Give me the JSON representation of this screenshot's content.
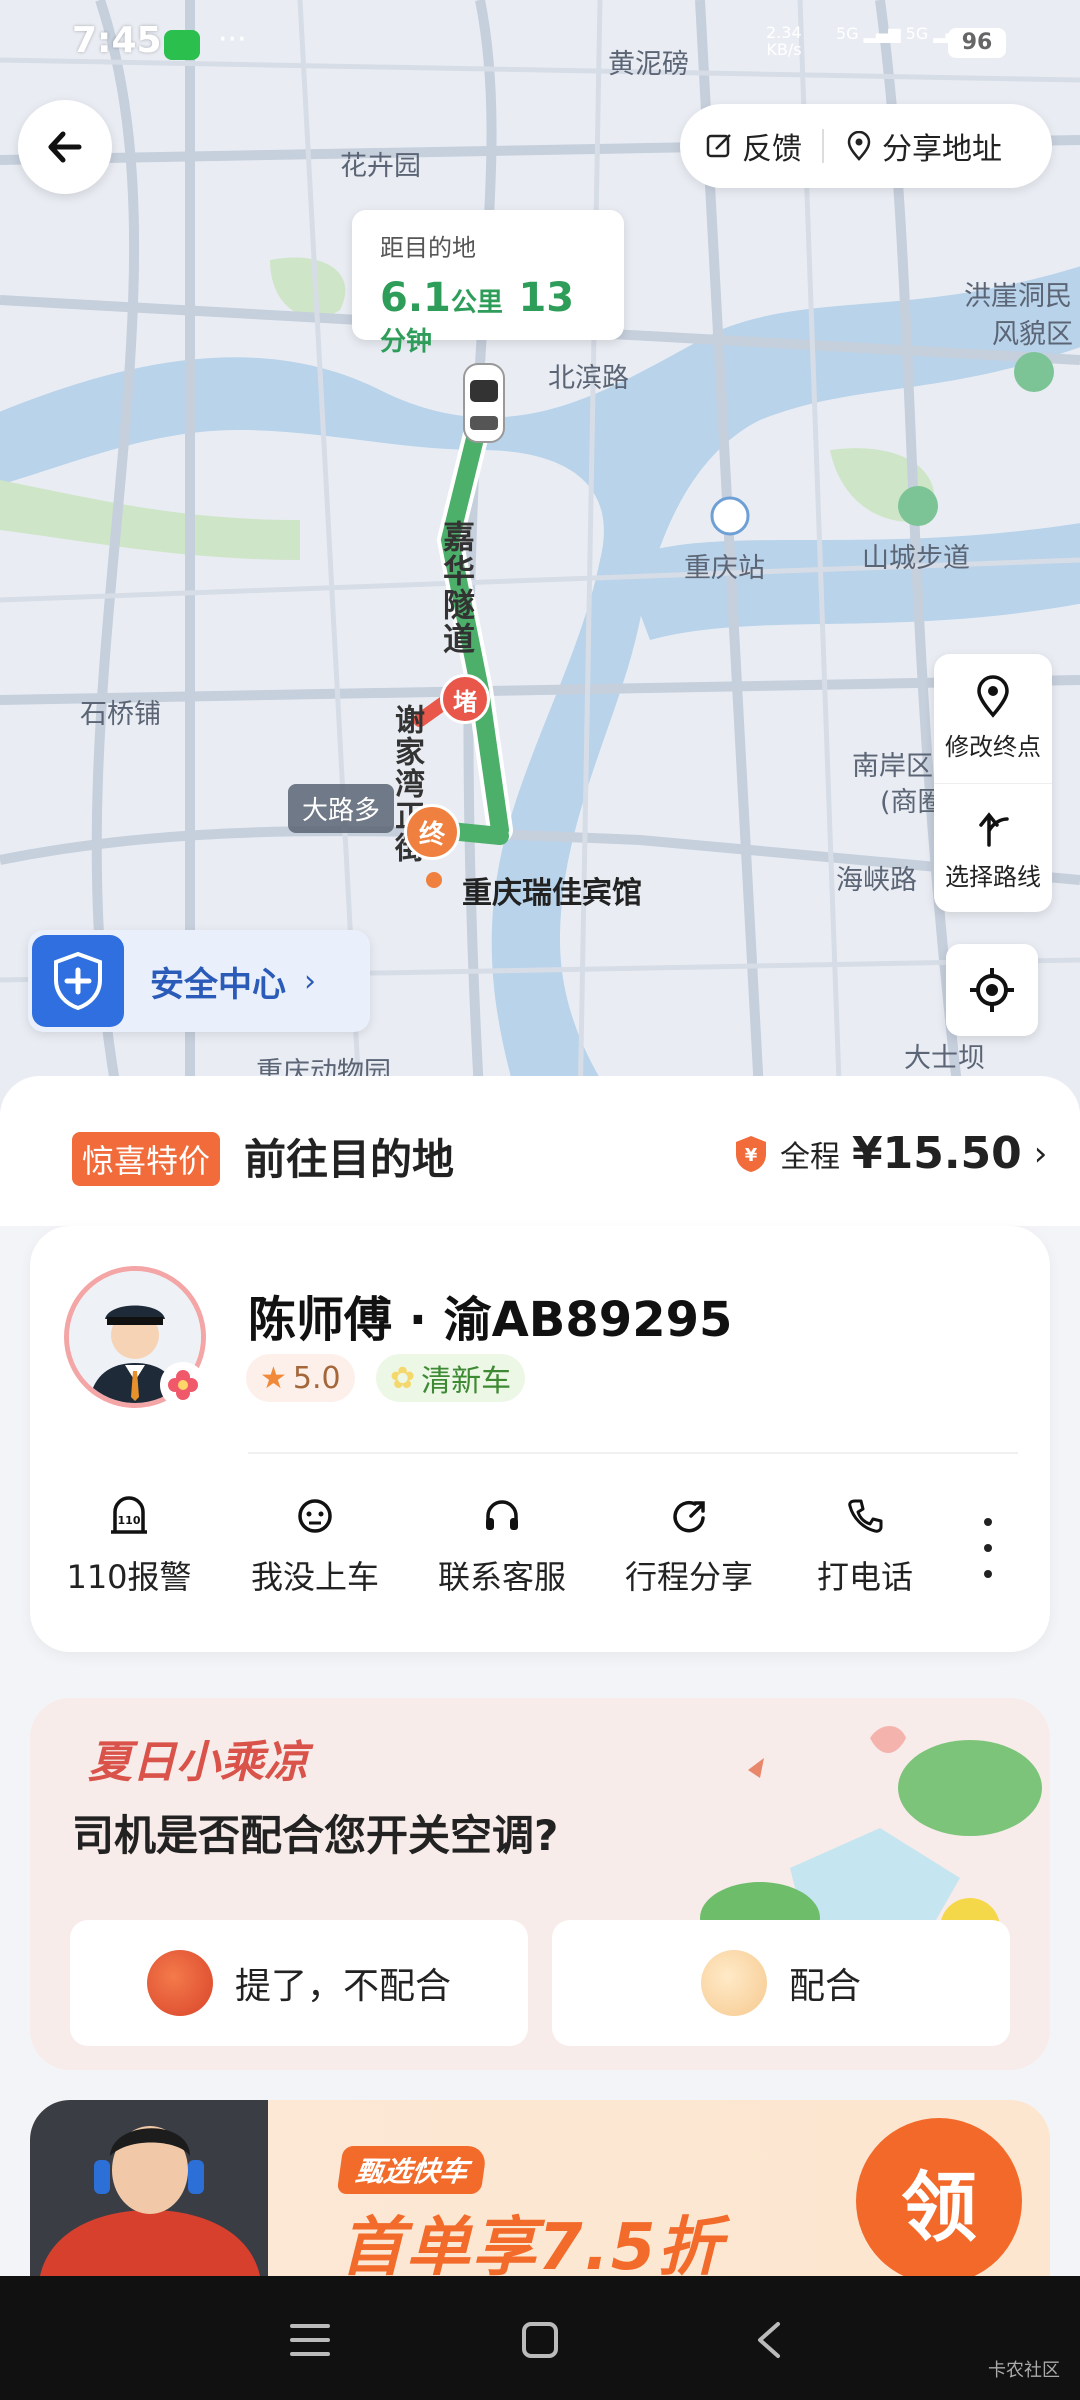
{
  "status_bar": {
    "time": "7:45",
    "net_speed": "2.34",
    "net_unit": "KB/s",
    "signal_1": "5G",
    "signal_2": "5G",
    "battery": "96"
  },
  "map": {
    "labels": {
      "huang_ni_bang": "黄泥磅",
      "hua_hui_yuan": "花卉园",
      "hong_ya_dong": "洪崖洞民",
      "feng_mao_qu": "风貌区",
      "bei_bin_lu": "北滨路",
      "chongqing_station": "重庆站",
      "shan_cheng_bu_dao": "山城步道",
      "shi_qiao_pu": "石桥铺",
      "nan_an_qu": "南岸区",
      "shang_quan": "(商圈",
      "hai_xia_lu": "海峡路",
      "jia_hua_tunnel": "嘉华隧道",
      "xie_jia_wan": "谢家湾正街",
      "destination_name": "重庆瑞佳宾馆",
      "zoo": "重庆动物园",
      "da_shi_ba": "大士坝"
    },
    "route_tag": "大路多",
    "end_marker": "终",
    "jam_marker": "堵",
    "route_colors": {
      "normal": "#4caf6a",
      "jam": "#e8574a"
    }
  },
  "top_actions": {
    "feedback": "反馈",
    "share_address": "分享地址"
  },
  "distance_card": {
    "title": "距目的地",
    "distance": "6.1",
    "distance_unit": "公里",
    "time": "13",
    "time_unit": "分钟"
  },
  "side_controls": {
    "modify_destination": "修改终点",
    "choose_route": "选择路线"
  },
  "safety": {
    "label": "安全中心",
    "chevron": "›"
  },
  "sheet": {
    "promo_tag": "惊喜特价",
    "title": "前往目的地",
    "fare_label": "全程",
    "fare_price": "¥15.50",
    "fare_chevron": "›"
  },
  "driver": {
    "name": "陈师傅 · 渝AB89295",
    "rating": "5.0",
    "car_tag": "清新车"
  },
  "actions": [
    {
      "label": "110报警",
      "icon": "police-110-icon"
    },
    {
      "label": "我没上车",
      "icon": "face-icon"
    },
    {
      "label": "联系客服",
      "icon": "headset-icon"
    },
    {
      "label": "行程分享",
      "icon": "share-icon"
    },
    {
      "label": "打电话",
      "icon": "phone-icon"
    }
  ],
  "survey": {
    "header": "夏日小乘凉",
    "question": "司机是否配合您开关空调?",
    "option_no": "提了，不配合",
    "option_yes": "配合"
  },
  "banner": {
    "pill": "甄选快车",
    "headline": "首单享7.5折",
    "claim": "领"
  },
  "watermark": "卡农社区",
  "colors": {
    "accent_orange": "#f26b3a",
    "accent_green": "#2f9d5a",
    "safety_blue": "#2f6fe0"
  }
}
